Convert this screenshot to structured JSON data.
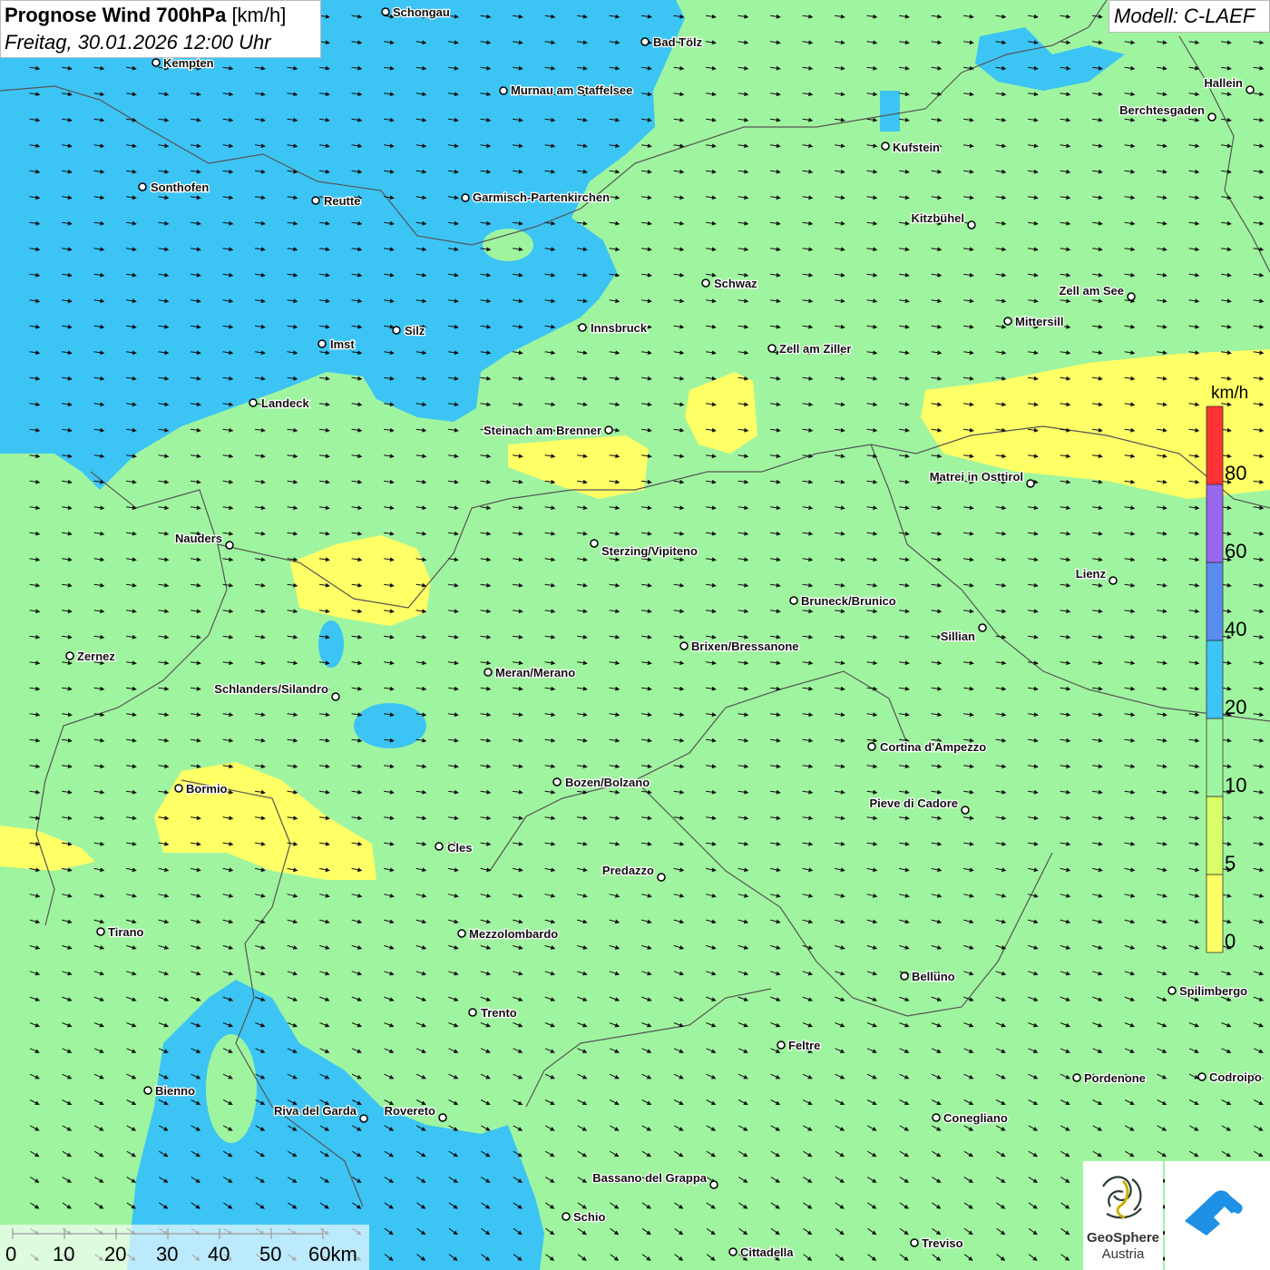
{
  "title": {
    "main_bold": "Prognose Wind 700hPa",
    "main_unit": "[km/h]",
    "datetime": "Freitag, 30.01.2026 12:00 Uhr"
  },
  "model": {
    "label": "Modell: C-LAEF"
  },
  "legend": {
    "unit": "km/h",
    "ticks": [
      "0",
      "5",
      "10",
      "20",
      "40",
      "60",
      "80"
    ],
    "bands": [
      {
        "from": 0,
        "to": 5,
        "color": "#ffff66"
      },
      {
        "from": 5,
        "to": 10,
        "color": "#d8ff66"
      },
      {
        "from": 10,
        "to": 20,
        "color": "#9ff59f"
      },
      {
        "from": 20,
        "to": 40,
        "color": "#3cc4f5"
      },
      {
        "from": 40,
        "to": 60,
        "color": "#5a8cf0"
      },
      {
        "from": 60,
        "to": 80,
        "color": "#9966ee"
      },
      {
        "from": 80,
        "to": 100,
        "color": "#ff3333"
      }
    ]
  },
  "scalebar": {
    "labels": [
      "0",
      "10",
      "20",
      "30",
      "40",
      "50",
      "60km"
    ]
  },
  "logos": {
    "geosphere_name": "GeoSphere",
    "geosphere_sub": "Austria"
  },
  "cities": [
    "Schongau",
    "Bad Tölz",
    "Kempten",
    "Murnau am Staffelsee",
    "Hallein",
    "Berchtesgaden",
    "Kufstein",
    "Sonthofen",
    "Reutte",
    "Garmisch-Partenkirchen",
    "Kitzbühel",
    "Schwaz",
    "Zell am See",
    "Mittersill",
    "Imst",
    "Silz",
    "Innsbruck",
    "Zell am Ziller",
    "Landeck",
    "Steinach am Brenner",
    "Matrei in Osttirol",
    "Nauders",
    "Sterzing/Vipiteno",
    "Lienz",
    "Bruneck/Brunico",
    "Sillian",
    "Brixen/Bressanone",
    "Zernez",
    "Meran/Merano",
    "Schlanders/Silandro",
    "Cortina d'Ampezzo",
    "Bozen/Bolzano",
    "Bormio",
    "Pieve di Cadore",
    "Cles",
    "Predazzo",
    "Tirano",
    "Mezzolombardo",
    "Belluno",
    "Spilimbergo",
    "Trento",
    "Feltre",
    "Pordenone",
    "Codroipo",
    "Bienno",
    "Riva del Garda",
    "Rovereto",
    "Conegliano",
    "Bassano del Grappa",
    "Schio",
    "Treviso",
    "Cittadella"
  ]
}
